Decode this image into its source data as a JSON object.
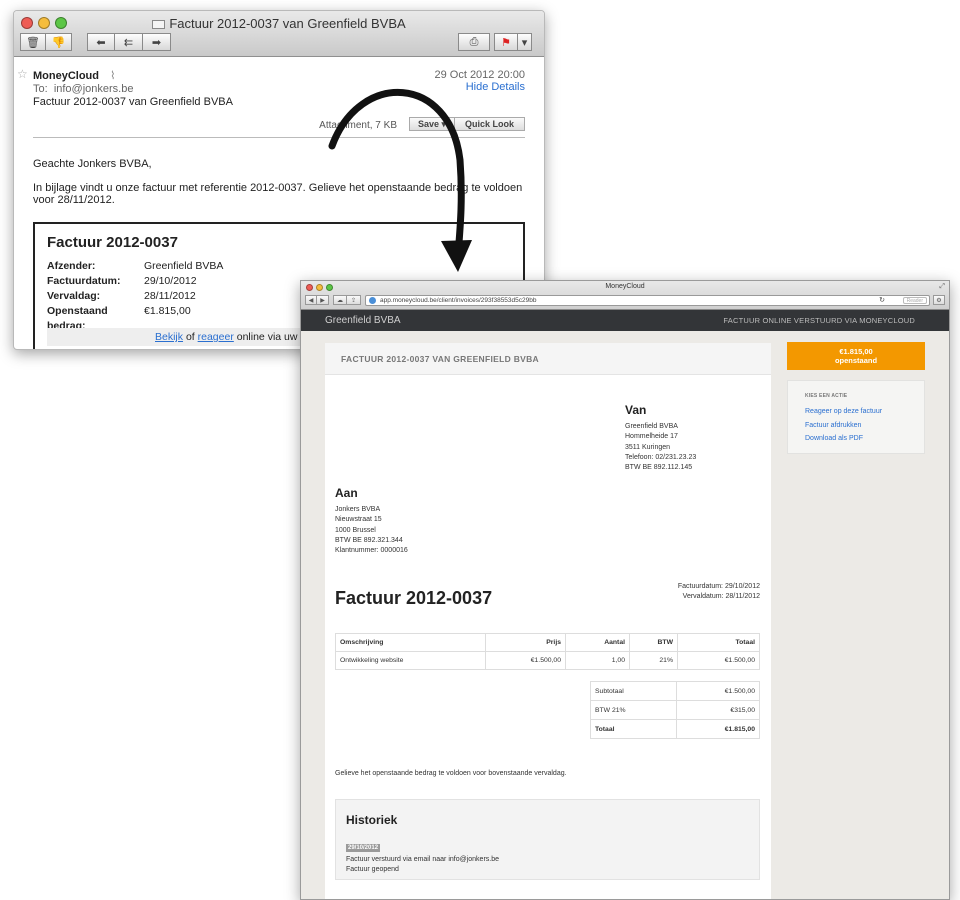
{
  "mail": {
    "window_title": "Factuur 2012-0037 van Greenfield BVBA",
    "from": "MoneyCloud",
    "date": "29 Oct 2012 20:00",
    "hide_details": "Hide Details",
    "to_label": "To:",
    "to": "info@jonkers.be",
    "subject": "Factuur 2012-0037 van Greenfield BVBA",
    "attachment": "Attachment, 7 KB",
    "save": "Save ▾",
    "quicklook": "Quick Look",
    "greeting": "Geachte Jonkers BVBA,",
    "paragraph": "In bijlage vindt u onze factuur met referentie 2012-0037. Gelieve het openstaande bedrag te voldoen voor 28/11/2012.",
    "invoice": {
      "title": "Factuur 2012-0037",
      "rows": [
        {
          "k": "Afzender:",
          "v": "Greenfield BVBA"
        },
        {
          "k": "Factuurdatum:",
          "v": "29/10/2012"
        },
        {
          "k": "Vervaldag:",
          "v": "28/11/2012"
        },
        {
          "k": "Openstaand bedrag:",
          "v": "€1.815,00"
        }
      ],
      "link_view": "Bekijk",
      "of": "of",
      "link_reply": "reageer",
      "tail": "online via uw per"
    }
  },
  "browser": {
    "window_title": "MoneyCloud",
    "url": "app.moneycloud.be/client/invoices/293f38553d5c29bb",
    "reader": "Reader",
    "brand": "Greenfield BVBA",
    "nav_right": "FACTUUR ONLINE VERSTUURD VIA MONEYCLOUD"
  },
  "invoice_page": {
    "header": "FACTUUR 2012-0037 VAN GREENFIELD BVBA",
    "van": {
      "title": "Van",
      "lines": [
        "Greenfield BVBA",
        "Hommelheide 17",
        "3511 Kuringen",
        "Telefoon: 02/231.23.23",
        "BTW BE 892.112.145"
      ]
    },
    "aan": {
      "title": "Aan",
      "lines": [
        "Jonkers BVBA",
        "Nieuwstraat 15",
        "1000 Brussel",
        "BTW BE 892.321.344",
        "Klantnummer: 0000016"
      ]
    },
    "title": "Factuur 2012-0037",
    "dates": [
      "Factuurdatum: 29/10/2012",
      "Vervaldatum: 28/11/2012"
    ],
    "columns": [
      "Omschrijving",
      "Prijs",
      "Aantal",
      "BTW",
      "Totaal"
    ],
    "items": [
      [
        "Ontwikkeling website",
        "€1.500,00",
        "1,00",
        "21%",
        "€1.500,00"
      ]
    ],
    "totals": [
      [
        "Subtotaal",
        "€1.500,00"
      ],
      [
        "BTW 21%",
        "€315,00"
      ],
      [
        "Totaal",
        "€1.815,00"
      ]
    ],
    "note": "Gelieve het openstaande bedrag te voldoen voor bovenstaande vervaldag.",
    "history": {
      "title": "Historiek",
      "date": "29/10/2012",
      "entries": [
        "Factuur verstuurd via email naar info@jonkers.be",
        "Factuur geopend"
      ]
    }
  },
  "sidebar": {
    "amount": "€1.815,00",
    "status": "openstaand",
    "actions_title": "KIES EEN ACTIE",
    "actions": [
      "Reageer op deze factuur",
      "Factuur afdrukken",
      "Download als PDF"
    ]
  }
}
